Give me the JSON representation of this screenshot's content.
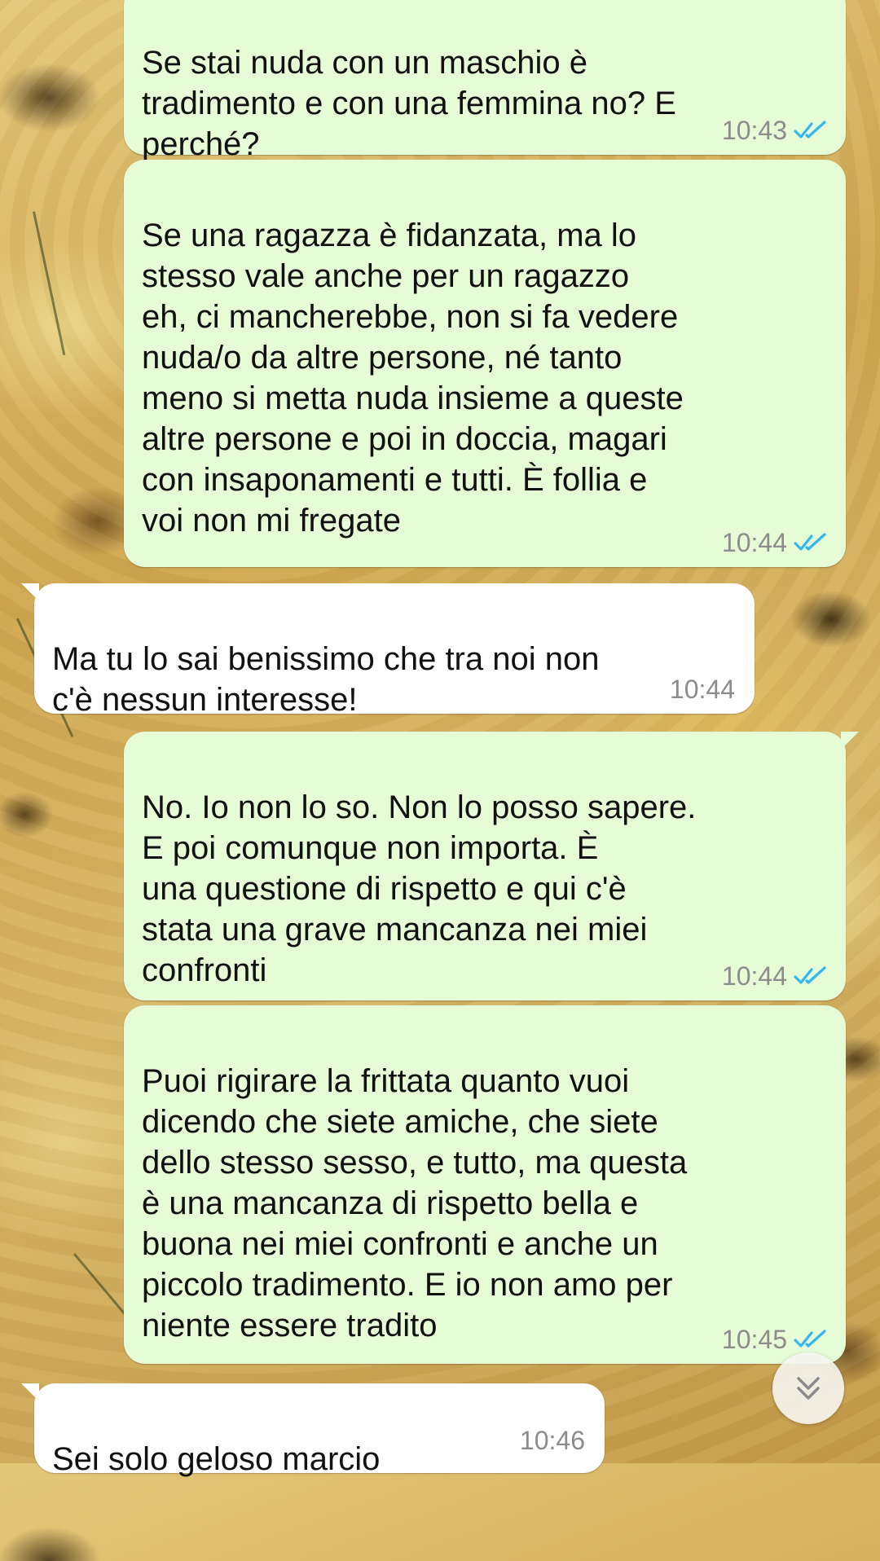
{
  "chat": {
    "messages": [
      {
        "direction": "out",
        "text": "Se stai nuda con un maschio è\ntradimento e con una femmina no? E\nperché?",
        "time": "10:43",
        "status": "read",
        "status_icon": "double-check-icon"
      },
      {
        "direction": "out",
        "text": "Se una ragazza è fidanzata, ma lo\nstesso vale anche per un ragazzo\neh, ci mancherebbe, non si fa vedere\nnuda/o da altre persone, né tanto\nmeno si metta nuda insieme a queste\naltre persone e poi in doccia, magari\ncon insaponamenti e tutti. È follia e\nvoi non mi fregate",
        "time": "10:44",
        "status": "read",
        "status_icon": "double-check-icon"
      },
      {
        "direction": "in",
        "text": "Ma tu lo sai benissimo che tra noi non\nc'è nessun interesse!",
        "time": "10:44"
      },
      {
        "direction": "out",
        "text": "No. Io non lo so. Non lo posso sapere.\nE poi comunque non importa. È\nuna questione di rispetto e qui c'è\nstata una grave mancanza nei miei\nconfronti",
        "time": "10:44",
        "status": "read",
        "status_icon": "double-check-icon"
      },
      {
        "direction": "out",
        "text": "Puoi rigirare la frittata quanto vuoi\ndicendo che siete amiche, che siete\ndello stesso sesso, e tutto, ma questa\nè una mancanza di rispetto bella e\nbuona nei miei confronti e anche un\npiccolo tradimento. E io non amo per\nniente essere tradito",
        "time": "10:45",
        "status": "read",
        "status_icon": "double-check-icon"
      },
      {
        "direction": "in",
        "text": "Sei solo geloso marcio",
        "time": "10:46"
      }
    ],
    "scroll_button_icon": "chevron-double-down-icon"
  },
  "colors": {
    "outgoing_bubble": "#e6fcd6",
    "incoming_bubble": "#ffffff",
    "read_ticks": "#34b7f1",
    "timestamp": "#8c8c8c"
  }
}
